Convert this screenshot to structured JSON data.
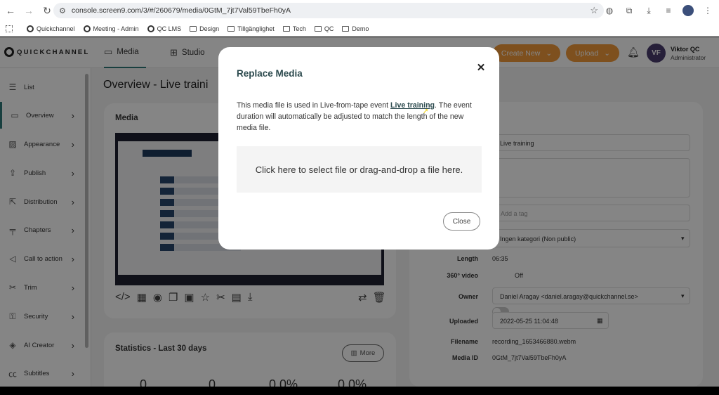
{
  "browser": {
    "url": "console.screen9.com/3/#/260679/media/0GtM_7jt7Val59TbeFh0yA",
    "bookmarks": [
      "Quickchannel",
      "Meeting - Admin",
      "QC LMS",
      "Design",
      "Tillgänglighet",
      "Tech",
      "QC",
      "Demo"
    ]
  },
  "app": {
    "logo": "QUICKCHANNEL",
    "tabs": [
      "Media",
      "Studio"
    ],
    "create_new": "Create New",
    "upload": "Upload",
    "user": {
      "initials": "VF",
      "name": "Viktor QC",
      "role": "Administrator"
    }
  },
  "sidebar": {
    "items": [
      {
        "label": "List",
        "icon": "list-icon"
      },
      {
        "label": "Overview",
        "icon": "monitor-icon"
      },
      {
        "label": "Appearance",
        "icon": "image-icon"
      },
      {
        "label": "Publish",
        "icon": "share-icon"
      },
      {
        "label": "Distribution",
        "icon": "external-link-icon"
      },
      {
        "label": "Chapters",
        "icon": "chapters-icon"
      },
      {
        "label": "Call to action",
        "icon": "megaphone-icon"
      },
      {
        "label": "Trim",
        "icon": "scissors-icon"
      },
      {
        "label": "Security",
        "icon": "lock-icon"
      },
      {
        "label": "AI Creator",
        "icon": "ai-icon"
      },
      {
        "label": "Subtitles",
        "icon": "cc-icon"
      }
    ]
  },
  "main": {
    "title": "Overview  -  Live traini",
    "media_card_title": "Media",
    "stats_title": "Statistics - Last 30 days",
    "more": "More",
    "stats": [
      "0",
      "0",
      "0.0%",
      "0.0%"
    ]
  },
  "details": {
    "title_value": "Live training",
    "tag_placeholder": "Add a tag",
    "category": "Ingen kategori (Non public)",
    "length_label": "Length",
    "length_value": "06:35",
    "video360_label": "360° video",
    "video360_value": "Off",
    "owner_label": "Owner",
    "owner_value": "Daniel Aragay <daniel.aragay@quickchannel.se>",
    "uploaded_label": "Uploaded",
    "uploaded_value": "2022-05-25 11:04:48",
    "filename_label": "Filename",
    "filename_value": "recording_1653466880.webm",
    "mediaid_label": "Media ID",
    "mediaid_value": "0GtM_7jt7Val59TbeFh0yA"
  },
  "modal": {
    "title": "Replace Media",
    "text_before": "This media file is used in Live-from-tape event ",
    "link": "Live training",
    "text_after": ". The event duration will automatically be adjusted to match the length of the new media file.",
    "dropzone": "Click here to select file or drag-and-drop a file here.",
    "close": "Close"
  }
}
